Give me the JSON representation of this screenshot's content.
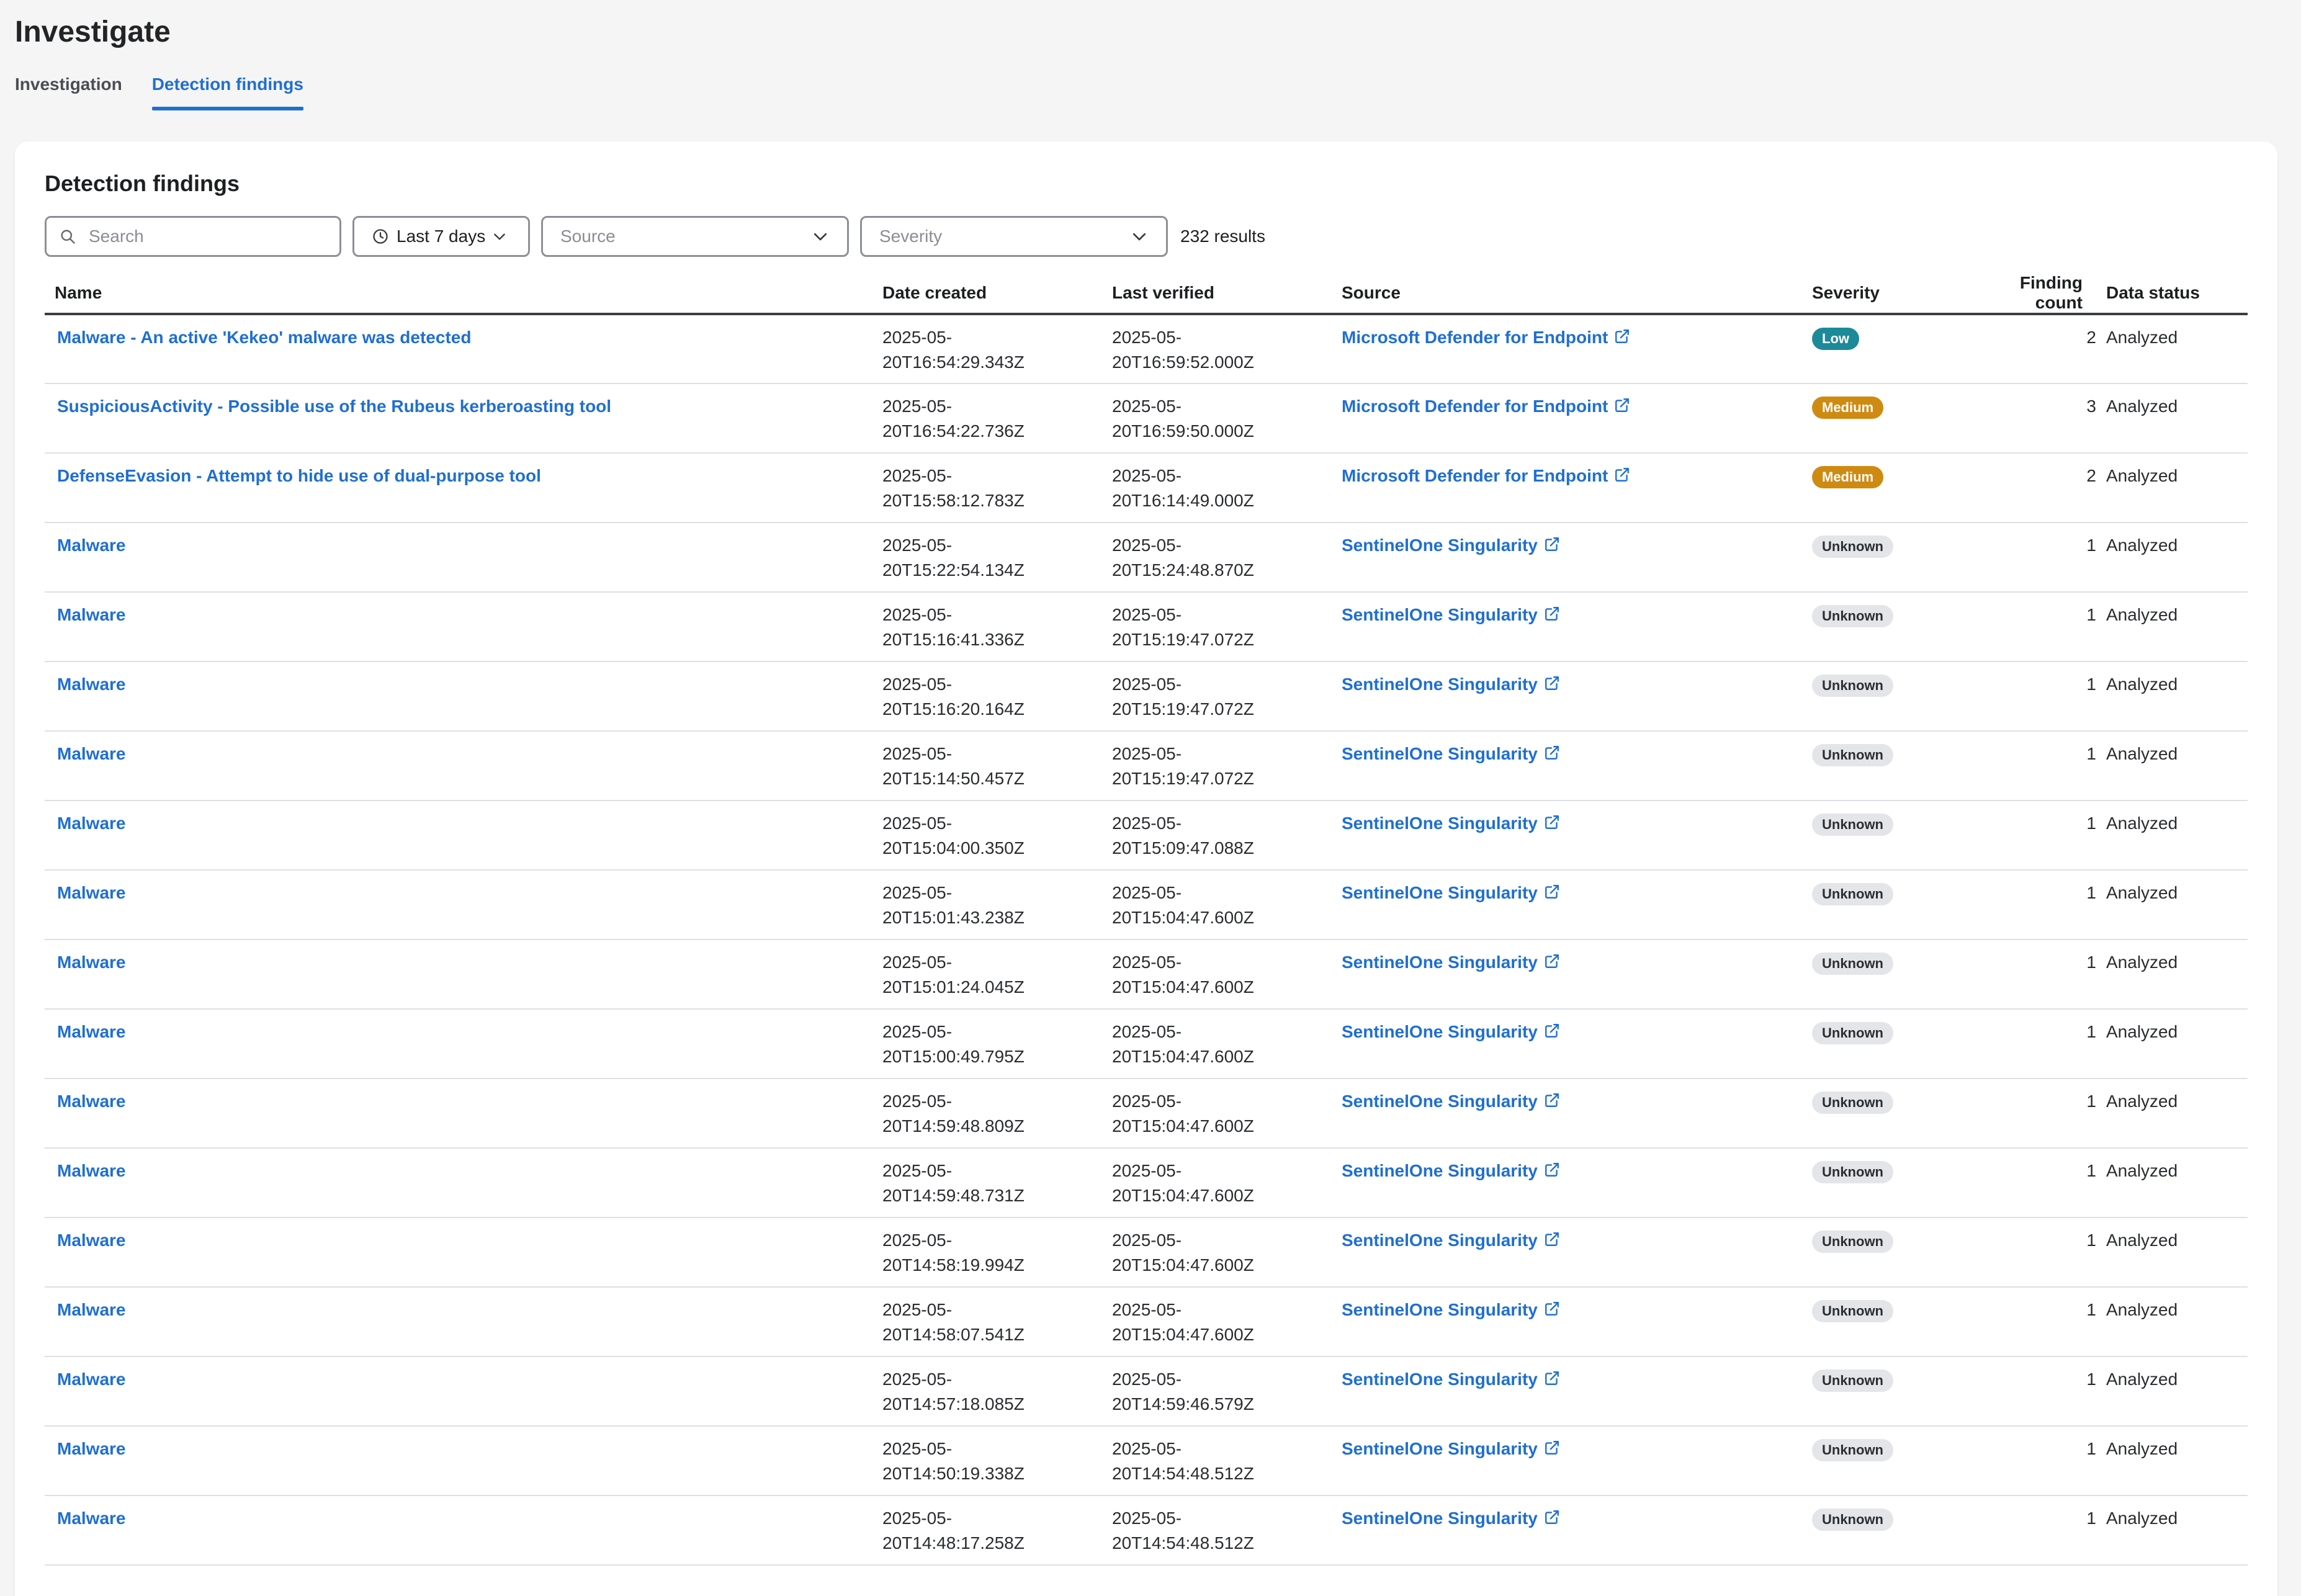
{
  "header": {
    "title": "Investigate"
  },
  "tabs": [
    {
      "label": "Investigation",
      "active": false
    },
    {
      "label": "Detection findings",
      "active": true
    }
  ],
  "panel": {
    "title": "Detection findings",
    "search_placeholder": "Search",
    "date_range": "Last 7 days",
    "source_placeholder": "Source",
    "severity_placeholder": "Severity",
    "results": "232 results"
  },
  "colors": {
    "accent": "#1f6fd1",
    "low": "#1d8a99",
    "medium": "#cf8a12",
    "unknown": "#e3e5e8"
  },
  "table": {
    "columns": [
      "Name",
      "Date created",
      "Last verified",
      "Source",
      "Severity",
      "Finding count",
      "Data status"
    ],
    "rows": [
      {
        "name": "Malware - An active 'Kekeo' malware was detected",
        "created_1": "2025-05-",
        "created_2": "20T16:54:29.343Z",
        "verified_1": "2025-05-",
        "verified_2": "20T16:59:52.000Z",
        "source": "Microsoft Defender for Endpoint",
        "severity": "Low",
        "severity_level": "low",
        "count": "2",
        "status": "Analyzed"
      },
      {
        "name": "SuspiciousActivity - Possible use of the Rubeus kerberoasting tool",
        "created_1": "2025-05-",
        "created_2": "20T16:54:22.736Z",
        "verified_1": "2025-05-",
        "verified_2": "20T16:59:50.000Z",
        "source": "Microsoft Defender for Endpoint",
        "severity": "Medium",
        "severity_level": "medium",
        "count": "3",
        "status": "Analyzed"
      },
      {
        "name": "DefenseEvasion - Attempt to hide use of dual-purpose tool",
        "created_1": "2025-05-",
        "created_2": "20T15:58:12.783Z",
        "verified_1": "2025-05-",
        "verified_2": "20T16:14:49.000Z",
        "source": "Microsoft Defender for Endpoint",
        "severity": "Medium",
        "severity_level": "medium",
        "count": "2",
        "status": "Analyzed"
      },
      {
        "name": "Malware",
        "created_1": "2025-05-",
        "created_2": "20T15:22:54.134Z",
        "verified_1": "2025-05-",
        "verified_2": "20T15:24:48.870Z",
        "source": "SentinelOne Singularity",
        "severity": "Unknown",
        "severity_level": "unknown",
        "count": "1",
        "status": "Analyzed"
      },
      {
        "name": "Malware",
        "created_1": "2025-05-",
        "created_2": "20T15:16:41.336Z",
        "verified_1": "2025-05-",
        "verified_2": "20T15:19:47.072Z",
        "source": "SentinelOne Singularity",
        "severity": "Unknown",
        "severity_level": "unknown",
        "count": "1",
        "status": "Analyzed"
      },
      {
        "name": "Malware",
        "created_1": "2025-05-",
        "created_2": "20T15:16:20.164Z",
        "verified_1": "2025-05-",
        "verified_2": "20T15:19:47.072Z",
        "source": "SentinelOne Singularity",
        "severity": "Unknown",
        "severity_level": "unknown",
        "count": "1",
        "status": "Analyzed"
      },
      {
        "name": "Malware",
        "created_1": "2025-05-",
        "created_2": "20T15:14:50.457Z",
        "verified_1": "2025-05-",
        "verified_2": "20T15:19:47.072Z",
        "source": "SentinelOne Singularity",
        "severity": "Unknown",
        "severity_level": "unknown",
        "count": "1",
        "status": "Analyzed"
      },
      {
        "name": "Malware",
        "created_1": "2025-05-",
        "created_2": "20T15:04:00.350Z",
        "verified_1": "2025-05-",
        "verified_2": "20T15:09:47.088Z",
        "source": "SentinelOne Singularity",
        "severity": "Unknown",
        "severity_level": "unknown",
        "count": "1",
        "status": "Analyzed"
      },
      {
        "name": "Malware",
        "created_1": "2025-05-",
        "created_2": "20T15:01:43.238Z",
        "verified_1": "2025-05-",
        "verified_2": "20T15:04:47.600Z",
        "source": "SentinelOne Singularity",
        "severity": "Unknown",
        "severity_level": "unknown",
        "count": "1",
        "status": "Analyzed"
      },
      {
        "name": "Malware",
        "created_1": "2025-05-",
        "created_2": "20T15:01:24.045Z",
        "verified_1": "2025-05-",
        "verified_2": "20T15:04:47.600Z",
        "source": "SentinelOne Singularity",
        "severity": "Unknown",
        "severity_level": "unknown",
        "count": "1",
        "status": "Analyzed"
      },
      {
        "name": "Malware",
        "created_1": "2025-05-",
        "created_2": "20T15:00:49.795Z",
        "verified_1": "2025-05-",
        "verified_2": "20T15:04:47.600Z",
        "source": "SentinelOne Singularity",
        "severity": "Unknown",
        "severity_level": "unknown",
        "count": "1",
        "status": "Analyzed"
      },
      {
        "name": "Malware",
        "created_1": "2025-05-",
        "created_2": "20T14:59:48.809Z",
        "verified_1": "2025-05-",
        "verified_2": "20T15:04:47.600Z",
        "source": "SentinelOne Singularity",
        "severity": "Unknown",
        "severity_level": "unknown",
        "count": "1",
        "status": "Analyzed"
      },
      {
        "name": "Malware",
        "created_1": "2025-05-",
        "created_2": "20T14:59:48.731Z",
        "verified_1": "2025-05-",
        "verified_2": "20T15:04:47.600Z",
        "source": "SentinelOne Singularity",
        "severity": "Unknown",
        "severity_level": "unknown",
        "count": "1",
        "status": "Analyzed"
      },
      {
        "name": "Malware",
        "created_1": "2025-05-",
        "created_2": "20T14:58:19.994Z",
        "verified_1": "2025-05-",
        "verified_2": "20T15:04:47.600Z",
        "source": "SentinelOne Singularity",
        "severity": "Unknown",
        "severity_level": "unknown",
        "count": "1",
        "status": "Analyzed"
      },
      {
        "name": "Malware",
        "created_1": "2025-05-",
        "created_2": "20T14:58:07.541Z",
        "verified_1": "2025-05-",
        "verified_2": "20T15:04:47.600Z",
        "source": "SentinelOne Singularity",
        "severity": "Unknown",
        "severity_level": "unknown",
        "count": "1",
        "status": "Analyzed"
      },
      {
        "name": "Malware",
        "created_1": "2025-05-",
        "created_2": "20T14:57:18.085Z",
        "verified_1": "2025-05-",
        "verified_2": "20T14:59:46.579Z",
        "source": "SentinelOne Singularity",
        "severity": "Unknown",
        "severity_level": "unknown",
        "count": "1",
        "status": "Analyzed"
      },
      {
        "name": "Malware",
        "created_1": "2025-05-",
        "created_2": "20T14:50:19.338Z",
        "verified_1": "2025-05-",
        "verified_2": "20T14:54:48.512Z",
        "source": "SentinelOne Singularity",
        "severity": "Unknown",
        "severity_level": "unknown",
        "count": "1",
        "status": "Analyzed"
      },
      {
        "name": "Malware",
        "created_1": "2025-05-",
        "created_2": "20T14:48:17.258Z",
        "verified_1": "2025-05-",
        "verified_2": "20T14:54:48.512Z",
        "source": "SentinelOne Singularity",
        "severity": "Unknown",
        "severity_level": "unknown",
        "count": "1",
        "status": "Analyzed"
      }
    ]
  }
}
